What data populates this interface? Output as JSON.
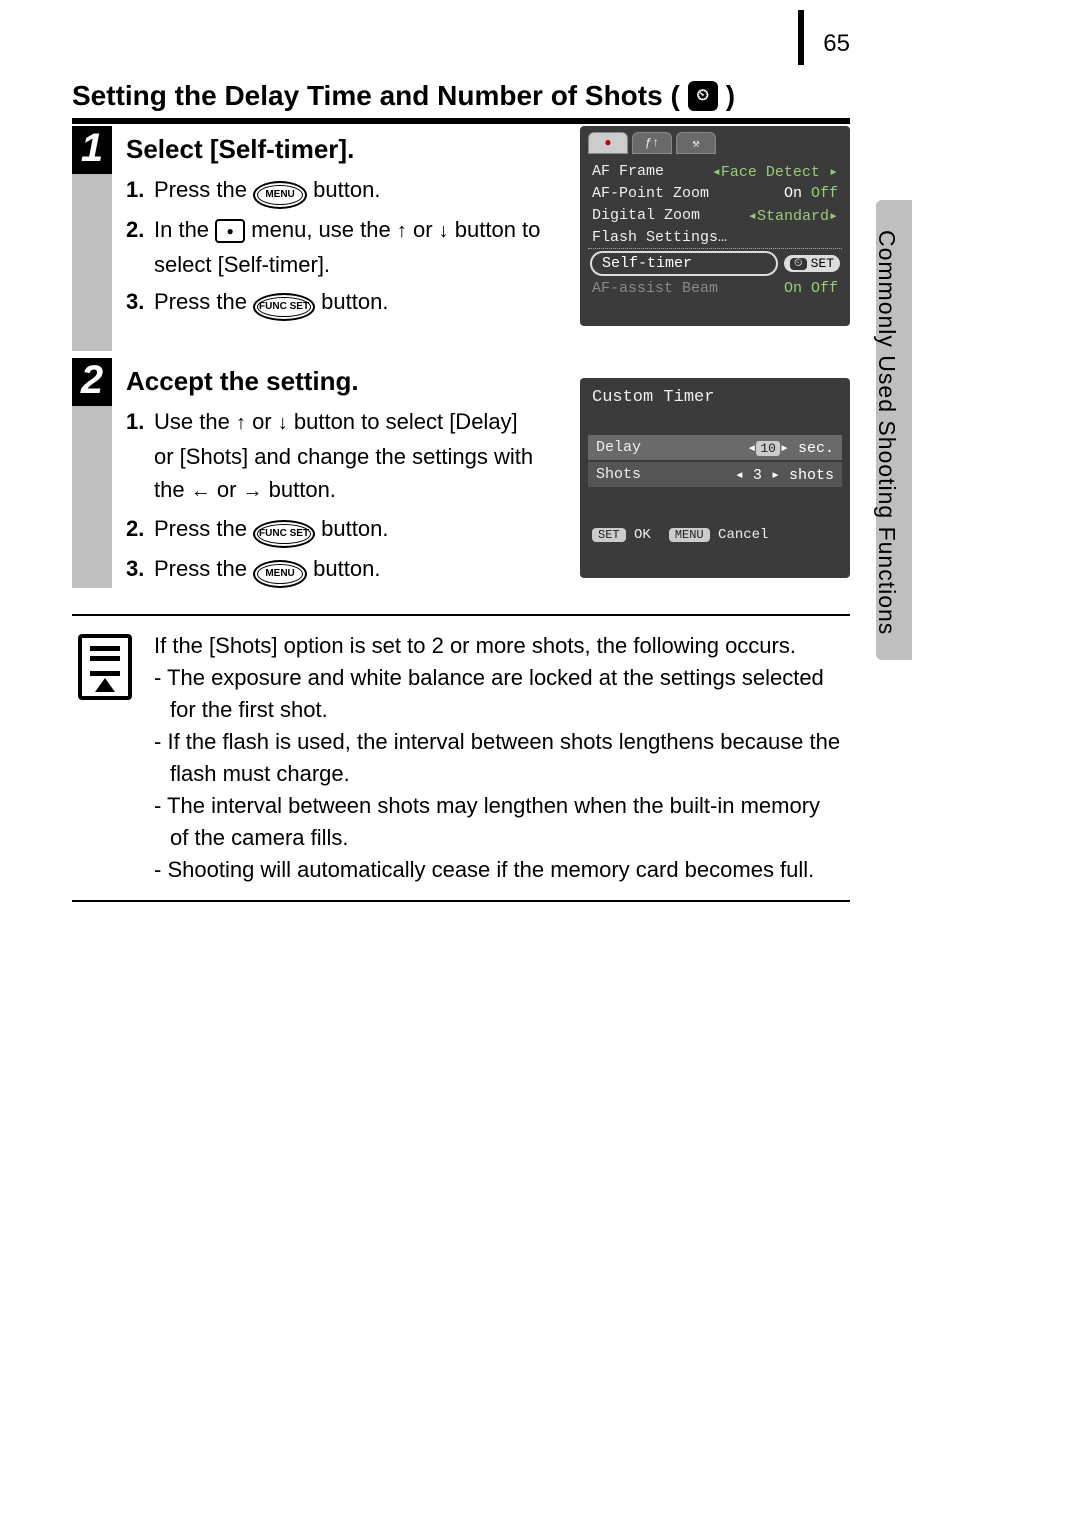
{
  "page_number": "65",
  "section_title": "Setting the Delay Time and Number of Shots (",
  "section_title_end": ")",
  "side_label": "Commonly Used Shooting Functions",
  "steps": [
    {
      "num": "1",
      "heading": "Select [Self-timer].",
      "items": [
        {
          "n": "1.",
          "pre": "Press the ",
          "btn": "MENU",
          "post": " button."
        },
        {
          "n": "2.",
          "pre": "In the ",
          "icon": "rec",
          "mid": " menu, use the ",
          "a1": "↑",
          "or": " or ",
          "a2": "↓",
          "post2": " button to select [Self-timer]."
        },
        {
          "n": "3.",
          "pre": "Press the ",
          "btn": "FUNC SET",
          "post": " button."
        }
      ]
    },
    {
      "num": "2",
      "heading": "Accept the setting.",
      "items": [
        {
          "n": "1.",
          "pre": "Use the ",
          "a1": "↑",
          "or": " or ",
          "a2": "↓",
          "mid": " button to select [Delay] or [Shots] and change the settings with the ",
          "a3": "←",
          "or2": " or ",
          "a4": "→",
          "post": " button."
        },
        {
          "n": "2.",
          "pre": "Press the ",
          "btn": "FUNC SET",
          "post": " button."
        },
        {
          "n": "3.",
          "pre": "Press the ",
          "btn": "MENU",
          "post": " button."
        }
      ]
    }
  ],
  "lcd1": {
    "tabs": [
      "●",
      "ƒ↑",
      "⚒"
    ],
    "rows": [
      {
        "label": "AF Frame",
        "opt_left": "◂",
        "opt": "Face Detect",
        "opt_right": "▸"
      },
      {
        "label": "AF-Point Zoom",
        "on": "On",
        "off": "Off"
      },
      {
        "label": "Digital Zoom",
        "opt_left": "◂",
        "opt": "Standard",
        "opt_right": "▸"
      },
      {
        "label": "Flash Settings…"
      }
    ],
    "sel_label": "Self-timer",
    "sel_badge_icon": "⏲",
    "sel_badge": "SET",
    "dimrow": {
      "label": "AF-assist Beam",
      "on": "On",
      "off": "Off"
    }
  },
  "lcd2": {
    "title": "Custom Timer",
    "rows": [
      {
        "label": "Delay",
        "left": "◂",
        "val": "10",
        "right": "▸",
        "unit": "sec."
      },
      {
        "label": "Shots",
        "left": "◂",
        "val": "3",
        "right": "▸",
        "unit": "shots"
      }
    ],
    "foot": [
      {
        "b": "SET",
        "t": "OK"
      },
      {
        "b": "MENU",
        "t": "Cancel"
      }
    ]
  },
  "note": {
    "intro": "If the [Shots] option is set to 2 or more shots, the following occurs.",
    "bullets": [
      "The exposure and white balance are locked at the settings selected for the first shot.",
      "If the flash is used, the interval between shots lengthens because the flash must charge.",
      "The interval between shots may lengthen when the built-in memory of the camera fills.",
      "Shooting will automatically cease if the memory card becomes full."
    ]
  }
}
